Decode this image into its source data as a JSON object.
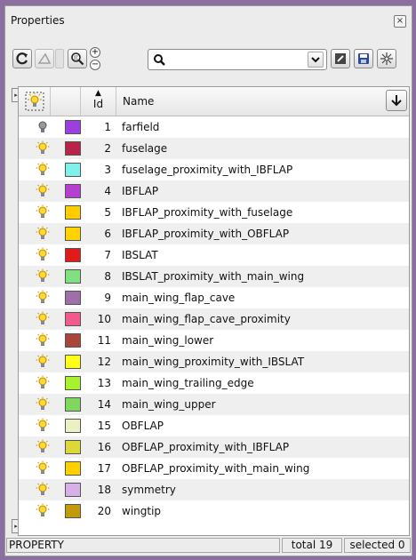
{
  "panel": {
    "title": "Properties",
    "close_symbol": "×"
  },
  "search": {
    "value": "",
    "placeholder": ""
  },
  "columns": {
    "id": "Id",
    "name": "Name"
  },
  "rows": [
    {
      "id": "1",
      "name": "farfield",
      "color": "#9b3fe0",
      "visible": false
    },
    {
      "id": "2",
      "name": "fuselage",
      "color": "#b7234a",
      "visible": true
    },
    {
      "id": "3",
      "name": "fuselage_proximity_with_IBFLAP",
      "color": "#7ff0ea",
      "visible": true
    },
    {
      "id": "4",
      "name": "IBFLAP",
      "color": "#b43fd0",
      "visible": true
    },
    {
      "id": "5",
      "name": "IBFLAP_proximity_with_fuselage",
      "color": "#ffcc00",
      "visible": true
    },
    {
      "id": "6",
      "name": "IBFLAP_proximity_with_OBFLAP",
      "color": "#ffd200",
      "visible": true
    },
    {
      "id": "7",
      "name": "IBSLAT",
      "color": "#e01b1b",
      "visible": true
    },
    {
      "id": "8",
      "name": "IBSLAT_proximity_with_main_wing",
      "color": "#7fe07f",
      "visible": true
    },
    {
      "id": "9",
      "name": "main_wing_flap_cave",
      "color": "#9d70a8",
      "visible": true
    },
    {
      "id": "10",
      "name": "main_wing_flap_cave_proximity",
      "color": "#f05a8c",
      "visible": true
    },
    {
      "id": "11",
      "name": "main_wing_lower",
      "color": "#a9463a",
      "visible": true
    },
    {
      "id": "12",
      "name": "main_wing_proximity_with_IBSLAT",
      "color": "#ffff1a",
      "visible": true
    },
    {
      "id": "13",
      "name": "main_wing_trailing_edge",
      "color": "#a8f030",
      "visible": true
    },
    {
      "id": "14",
      "name": "main_wing_upper",
      "color": "#7ed85e",
      "visible": true
    },
    {
      "id": "15",
      "name": "OBFLAP",
      "color": "#ecf0c4",
      "visible": true
    },
    {
      "id": "16",
      "name": "OBFLAP_proximity_with_IBFLAP",
      "color": "#dcd83a",
      "visible": true
    },
    {
      "id": "17",
      "name": "OBFLAP_proximity_with_main_wing",
      "color": "#ffd000",
      "visible": true
    },
    {
      "id": "18",
      "name": "symmetry",
      "color": "#d8b0e8",
      "visible": true
    },
    {
      "id": "20",
      "name": "wingtip",
      "color": "#c39a0c",
      "visible": true
    }
  ],
  "status": {
    "mode": "PROPERTY",
    "total": "total 19",
    "selected": "selected 0"
  }
}
